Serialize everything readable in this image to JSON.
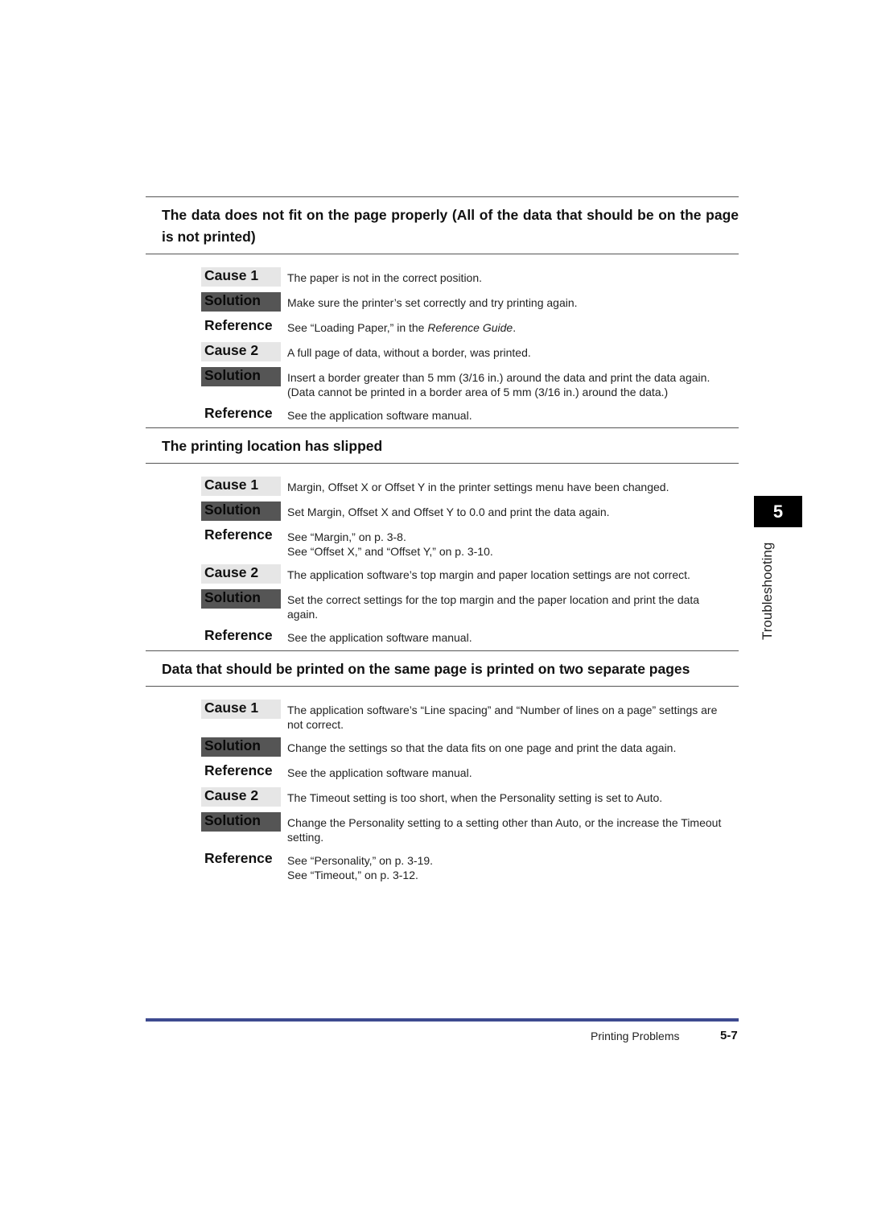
{
  "sections": [
    {
      "heading": "The data does not fit on the page properly (All of the data that should be on the page is not printed)",
      "rows": [
        {
          "type": "cause",
          "label": "Cause 1",
          "lines": [
            "The paper is not in the correct position."
          ]
        },
        {
          "type": "solution",
          "label": "Solution",
          "lines": [
            "Make sure the printer’s set correctly and try printing again."
          ]
        },
        {
          "type": "reference",
          "label": "Reference",
          "lines": [
            "See “Loading Paper,” in the "
          ],
          "italic": "Reference Guide",
          "suffix": "."
        },
        {
          "type": "cause",
          "label": "Cause 2",
          "lines": [
            "A full page of data, without a border, was printed."
          ]
        },
        {
          "type": "solution",
          "label": "Solution",
          "lines": [
            "Insert a border greater than 5 mm (3/16 in.) around the data and print the data again.",
            "(Data cannot be printed in a border area of 5 mm (3/16 in.) around the data.)"
          ]
        },
        {
          "type": "reference",
          "label": "Reference",
          "lines": [
            "See the application software manual."
          ]
        }
      ]
    },
    {
      "heading": "The printing location has slipped",
      "rows": [
        {
          "type": "cause",
          "label": "Cause 1",
          "lines": [
            "Margin, Offset X or Offset Y in the printer settings menu have been changed."
          ]
        },
        {
          "type": "solution",
          "label": "Solution",
          "lines": [
            "Set Margin, Offset X and Offset Y to 0.0 and print the data again."
          ]
        },
        {
          "type": "reference",
          "label": "Reference",
          "lines": [
            "See “Margin,” on p. 3-8.",
            "See “Offset X,” and “Offset Y,” on p. 3-10."
          ]
        },
        {
          "type": "cause",
          "label": "Cause 2",
          "lines": [
            "The application software’s top margin and paper location settings are not correct."
          ]
        },
        {
          "type": "solution",
          "label": "Solution",
          "lines": [
            "Set the correct settings for the top margin and the paper location and print the data",
            "again."
          ]
        },
        {
          "type": "reference",
          "label": "Reference",
          "lines": [
            "See the application software manual."
          ]
        }
      ]
    },
    {
      "heading": "Data that should be printed on the same page is printed on two separate pages",
      "rows": [
        {
          "type": "cause",
          "label": "Cause 1",
          "lines": [
            "The application software’s “Line spacing” and “Number of lines on a page” settings are",
            "not correct."
          ]
        },
        {
          "type": "solution",
          "label": "Solution",
          "lines": [
            "Change the settings so that the data fits on one page and print the data again."
          ]
        },
        {
          "type": "reference",
          "label": "Reference",
          "lines": [
            "See the application software manual."
          ]
        },
        {
          "type": "cause",
          "label": "Cause 2",
          "lines": [
            "The Timeout setting is too short, when the Personality setting is set to Auto."
          ]
        },
        {
          "type": "solution",
          "label": "Solution",
          "lines": [
            "Change the Personality setting to a setting other than Auto, or the increase the Timeout",
            "setting."
          ]
        },
        {
          "type": "reference",
          "label": "Reference",
          "lines": [
            "See “Personality,” on p. 3-19.",
            "See “Timeout,” on p. 3-12."
          ]
        }
      ]
    }
  ],
  "chapter": {
    "number": "5",
    "name": "Troubleshooting"
  },
  "footer": {
    "title": "Printing Problems",
    "page": "5-7",
    "rule_color": "#3d4a8f"
  }
}
